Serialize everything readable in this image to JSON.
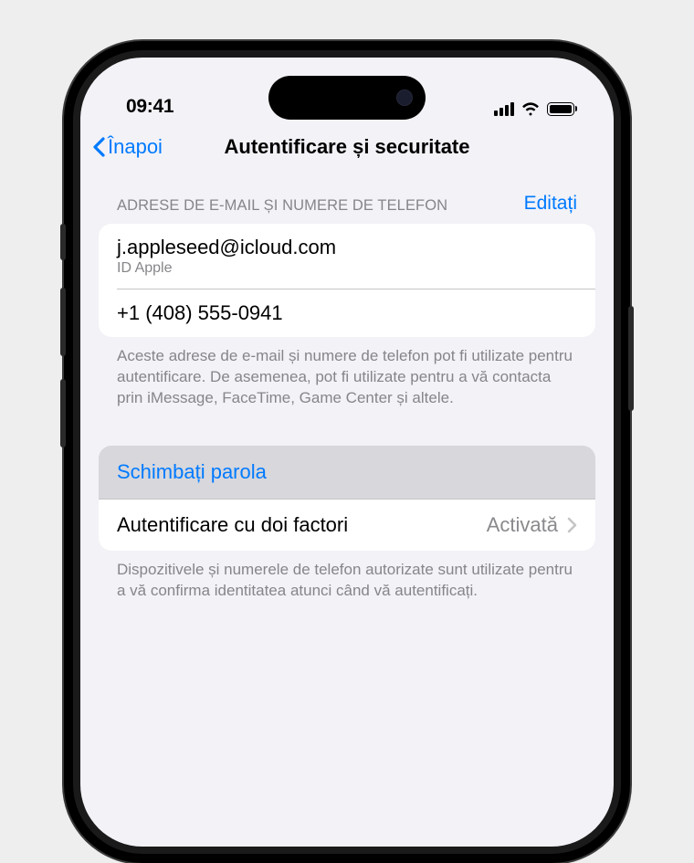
{
  "statusBar": {
    "time": "09:41"
  },
  "nav": {
    "back": "Înapoi",
    "title": "Autentificare și securitate"
  },
  "section1": {
    "header": "ADRESE DE E-MAIL ȘI NUMERE DE TELEFON",
    "edit": "Editați",
    "rows": [
      {
        "title": "j.appleseed@icloud.com",
        "subtitle": "ID Apple"
      },
      {
        "title": "+1 (408) 555-0941"
      }
    ],
    "footer": "Aceste adrese de e-mail și numere de telefon pot fi utilizate pentru autentificare. De asemenea, pot fi utilizate pentru a vă contacta prin iMessage, FaceTime, Game Center și altele."
  },
  "section2": {
    "changePassword": "Schimbați parola",
    "twoFactorLabel": "Autentificare cu doi factori",
    "twoFactorValue": "Activată",
    "footer": "Dispozitivele și numerele de telefon autorizate sunt utilizate pentru a vă confirma identitatea atunci când vă autentificați."
  }
}
